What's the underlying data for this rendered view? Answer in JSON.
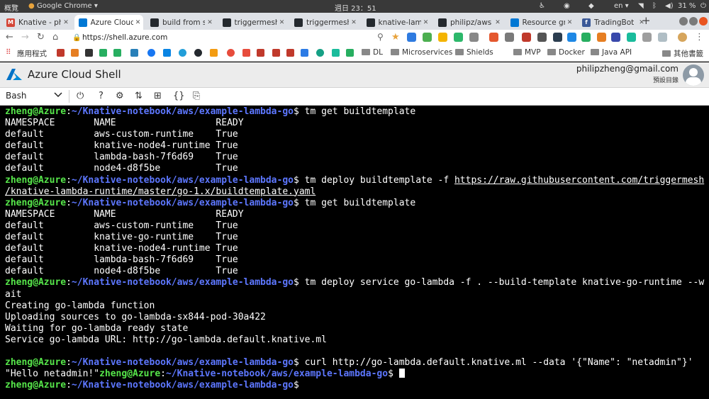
{
  "system_bar": {
    "overview": "概覽",
    "app_name": "Google Chrome ▾",
    "clock": "週日 23：51",
    "lang": "en ▾",
    "battery": "31 %"
  },
  "tabs": [
    {
      "label": "Knative - ph",
      "active": false,
      "color": "#d44638",
      "glyph": "M"
    },
    {
      "label": "Azure Cloud S",
      "active": true,
      "color": "#0078d4",
      "glyph": ""
    },
    {
      "label": "build from s",
      "active": false,
      "color": "#24292e",
      "glyph": ""
    },
    {
      "label": "triggermesh",
      "active": false,
      "color": "#24292e",
      "glyph": ""
    },
    {
      "label": "triggermesh",
      "active": false,
      "color": "#24292e",
      "glyph": ""
    },
    {
      "label": "knative-lamb",
      "active": false,
      "color": "#24292e",
      "glyph": ""
    },
    {
      "label": "philipz/aws",
      "active": false,
      "color": "#24292e",
      "glyph": ""
    },
    {
      "label": "Resource gr",
      "active": false,
      "color": "#0078d4",
      "glyph": ""
    },
    {
      "label": "TradingBot",
      "active": false,
      "color": "#3b5998",
      "glyph": "f"
    }
  ],
  "address": {
    "url": "https://shell.azure.com"
  },
  "bookmarks": {
    "apps": "應用程式",
    "folders": [
      "DL",
      "Microservices",
      "Shields",
      "MVP",
      "Docker",
      "Java API"
    ],
    "other": "其他書籤"
  },
  "app": {
    "title": "Azure Cloud Shell",
    "email": "philipzheng@gmail.com",
    "directory": "預設目錄"
  },
  "toolbar": {
    "shell": "Bash"
  },
  "terminal": {
    "user": "zheng@Azure",
    "path": "~/Knative-notebook/aws/example-lambda-go",
    "lines": [
      {
        "t": "prompt",
        "cmd": " tm get buildtemplate"
      },
      {
        "t": "out",
        "text": "NAMESPACE       NAME                  READY"
      },
      {
        "t": "out",
        "text": "default         aws-custom-runtime    True"
      },
      {
        "t": "out",
        "text": "default         knative-node4-runtime True"
      },
      {
        "t": "out",
        "text": "default         lambda-bash-7f6d69    True"
      },
      {
        "t": "out",
        "text": "default         node4-d8f5be          True"
      },
      {
        "t": "prompt",
        "cmd": " tm deploy buildtemplate -f ",
        "link": "https://raw.githubusercontent.com/triggermesh"
      },
      {
        "t": "link",
        "text": "/knative-lambda-runtime/master/go-1.x/buildtemplate.yaml"
      },
      {
        "t": "prompt",
        "cmd": " tm get buildtemplate"
      },
      {
        "t": "out",
        "text": "NAMESPACE       NAME                  READY"
      },
      {
        "t": "out",
        "text": "default         aws-custom-runtime    True"
      },
      {
        "t": "out",
        "text": "default         knative-go-runtime    True"
      },
      {
        "t": "out",
        "text": "default         knative-node4-runtime True"
      },
      {
        "t": "out",
        "text": "default         lambda-bash-7f6d69    True"
      },
      {
        "t": "out",
        "text": "default         node4-d8f5be          True"
      },
      {
        "t": "prompt",
        "cmd": " tm deploy service go-lambda -f . --build-template knative-go-runtime --w"
      },
      {
        "t": "out",
        "text": "ait"
      },
      {
        "t": "out",
        "text": "Creating go-lambda function"
      },
      {
        "t": "out",
        "text": "Uploading sources to go-lambda-sx844-pod-30a422"
      },
      {
        "t": "out",
        "text": "Waiting for go-lambda ready state"
      },
      {
        "t": "out",
        "text": "Service go-lambda URL: http://go-lambda.default.knative.ml"
      },
      {
        "t": "out",
        "text": ""
      },
      {
        "t": "prompt",
        "cmd": " curl http://go-lambda.default.knative.ml --data '{\"Name\": \"netadmin\"}'"
      },
      {
        "t": "hello",
        "pre": "\"Hello netadmin!\"",
        "cmd": " "
      },
      {
        "t": "prompt",
        "cmd": ""
      }
    ]
  }
}
